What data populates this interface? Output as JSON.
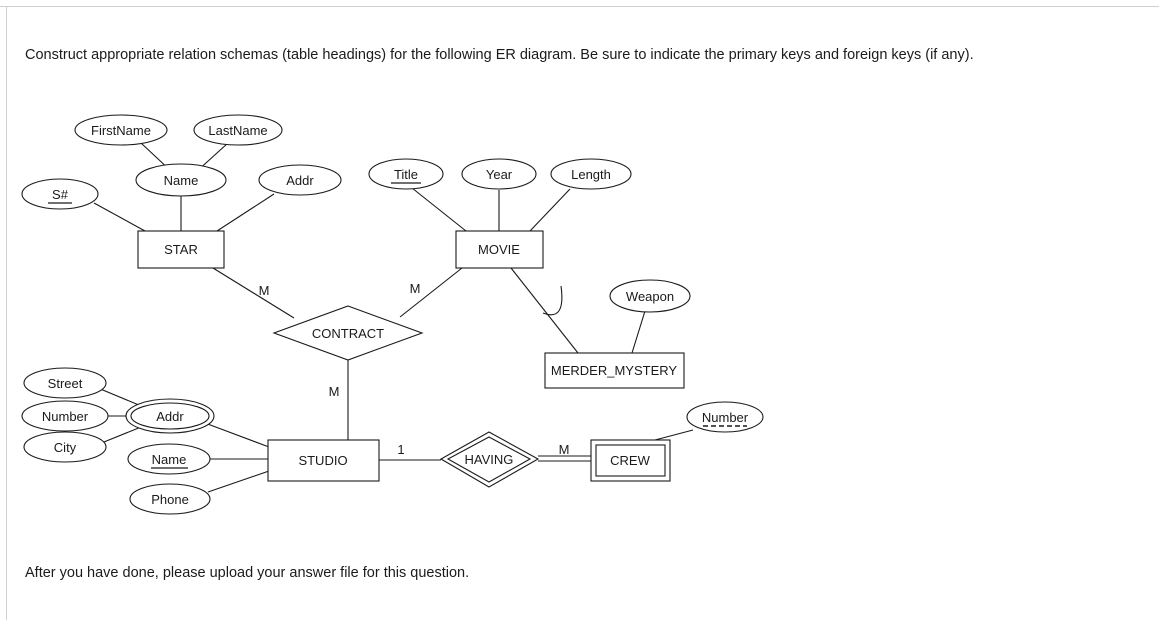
{
  "question": {
    "prompt": "Construct appropriate relation schemas (table headings) for the following ER diagram. Be sure to indicate the primary keys and foreign keys (if any).",
    "footer_note": "After you have done, please upload your answer file for this question."
  },
  "diagram": {
    "entities": {
      "star": {
        "label": "STAR",
        "type": "strong-entity"
      },
      "movie": {
        "label": "MOVIE",
        "type": "strong-entity"
      },
      "studio": {
        "label": "STUDIO",
        "type": "strong-entity"
      },
      "merder_mystery": {
        "label": "MERDER_MYSTERY",
        "type": "subclass-entity"
      },
      "crew": {
        "label": "CREW",
        "type": "weak-entity"
      }
    },
    "relationships": {
      "contract": {
        "label": "CONTRACT",
        "type": "diamond"
      },
      "having": {
        "label": "HAVING",
        "type": "double-diamond"
      }
    },
    "attributes": {
      "star_s_num": {
        "label": "S#",
        "key": "primary"
      },
      "star_name": {
        "label": "Name",
        "key": "none"
      },
      "star_first_name": {
        "label": "FirstName",
        "key": "none"
      },
      "star_last_name": {
        "label": "LastName",
        "key": "none"
      },
      "star_addr": {
        "label": "Addr",
        "key": "none"
      },
      "movie_title": {
        "label": "Title",
        "key": "primary"
      },
      "movie_year": {
        "label": "Year",
        "key": "none"
      },
      "movie_length": {
        "label": "Length",
        "key": "none"
      },
      "mystery_weapon": {
        "label": "Weapon",
        "key": "none"
      },
      "studio_addr": {
        "label": "Addr",
        "key": "none",
        "multivalued": true
      },
      "studio_street": {
        "label": "Street",
        "key": "none"
      },
      "studio_number": {
        "label": "Number",
        "key": "none"
      },
      "studio_city": {
        "label": "City",
        "key": "none"
      },
      "studio_name": {
        "label": "Name",
        "key": "primary"
      },
      "studio_phone": {
        "label": "Phone",
        "key": "none"
      },
      "crew_number": {
        "label": "Number",
        "key": "partial"
      }
    },
    "cardinalities": {
      "star_contract": "M",
      "movie_contract": "M",
      "contract_studio": "M",
      "studio_having": "1",
      "having_crew": "M"
    }
  }
}
